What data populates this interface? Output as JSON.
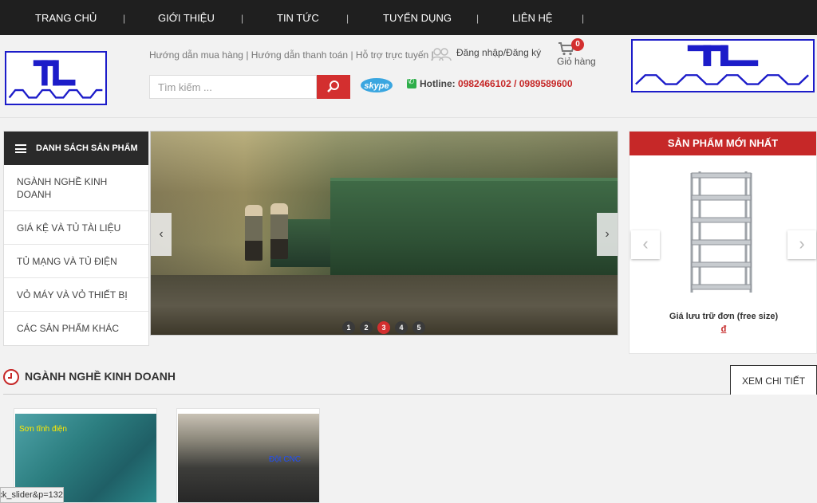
{
  "nav": {
    "items": [
      "TRANG CHỦ",
      "GIỚI THIỆU",
      "TIN TỨC",
      "TUYỂN DỤNG",
      "LIÊN HỆ"
    ],
    "separator": "|"
  },
  "header": {
    "links": [
      "Hướng dẫn mua hàng",
      "Hướng dẫn thanh toán",
      "Hỗ trợ trực tuyến"
    ],
    "link_sep": " | ",
    "login_label": "Đăng nhập/Đăng ký",
    "cart_count": "0",
    "cart_label": "Giỏ hàng",
    "search_placeholder": "Tìm kiếm ...",
    "hotline_label": "Hotline:",
    "hotline_numbers": "0982466102 / 0989589600"
  },
  "sidebar": {
    "title": "DANH SÁCH SẢN PHẨM",
    "items": [
      {
        "label": "NGÀNH NGHỀ KINH DOANH"
      },
      {
        "label": "GIÁ KỆ VÀ TỦ TÀI LIỆU"
      },
      {
        "label": "TỦ MẠNG VÀ TỦ ĐIỆN"
      },
      {
        "label": "VỎ MÁY VÀ VỎ THIẾT BỊ"
      },
      {
        "label": "CÁC SẢN PHẨM KHÁC"
      }
    ]
  },
  "slider": {
    "dots": [
      "1",
      "2",
      "3",
      "4",
      "5"
    ],
    "active_dot": "3",
    "prev_arrow": "‹",
    "next_arrow": "›"
  },
  "newest": {
    "title": "SẢN PHẨM MỚI NHẤT",
    "product_name": "Giá lưu trữ đơn (free size)",
    "product_price": "đ",
    "prev_arrow": "‹",
    "next_arrow": "›"
  },
  "section": {
    "title": "NGÀNH NGHỀ KINH DOANH",
    "detail_button": "XEM CHI TIẾT",
    "cards": [
      {
        "label": "Sơn tĩnh điện"
      },
      {
        "label": "Đột CNC"
      }
    ]
  },
  "status_url": "ck_slider&p=132",
  "colors": {
    "nav_bg": "#1f1f1f",
    "accent_red": "#c62828",
    "logo_blue": "#1c1cc9"
  }
}
